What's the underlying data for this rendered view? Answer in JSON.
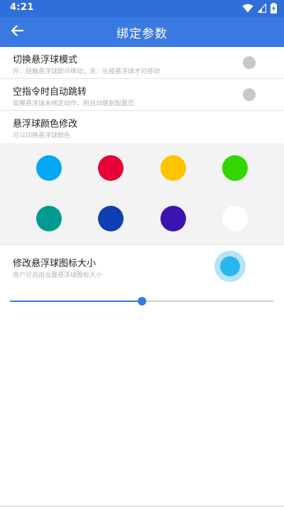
{
  "status_bar": {
    "time": "4:21",
    "icons": [
      "wifi-icon",
      "cell-signal-icon",
      "battery-charging-icon"
    ]
  },
  "app_bar": {
    "title": "绑定参数",
    "back_icon": "arrow-left-icon"
  },
  "settings": [
    {
      "title": "切换悬浮球模式",
      "subtitle": "开：轻触悬浮球即可移动；关：长按悬浮球才可移动",
      "toggle_on": false
    },
    {
      "title": "空指令时自动跳转",
      "subtitle": "如果悬浮球未绑定动作，则自动跳到配置页",
      "toggle_on": false
    },
    {
      "title": "悬浮球颜色修改",
      "subtitle": "可以切换悬浮球颜色"
    }
  ],
  "palette": {
    "colors": [
      "#03a9f4",
      "#e8003a",
      "#ffc400",
      "#33d600",
      "#009b8f",
      "#0e3fb0",
      "#3c13b1",
      "#ffffff"
    ]
  },
  "size_setting": {
    "title": "修改悬浮球图标大小",
    "subtitle": "用户可自由设置悬浮球图标大小",
    "preview_color": "#28b6ef",
    "slider_fraction": 0.5
  },
  "theme": {
    "primary": "#3a79e2",
    "status_bar": "#2f6fd9"
  }
}
